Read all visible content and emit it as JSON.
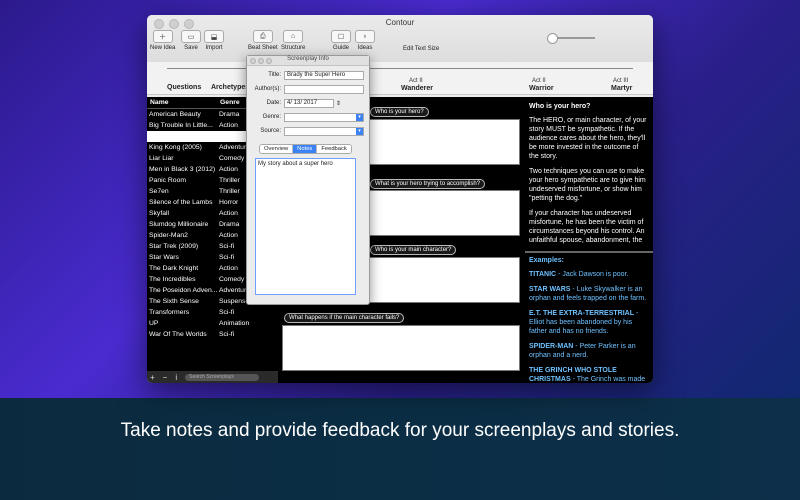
{
  "window": {
    "title": "Contour"
  },
  "toolbar": {
    "items": [
      {
        "label": "New Idea",
        "icon": "plus"
      },
      {
        "label": "Save",
        "icon": "save"
      },
      {
        "label": "Import",
        "icon": "import"
      },
      {
        "label": "Beat Sheet",
        "icon": "printer"
      },
      {
        "label": "Structure",
        "icon": "structure"
      },
      {
        "label": "Guide",
        "icon": "guide"
      },
      {
        "label": "Ideas",
        "icon": "lightbulb"
      },
      {
        "label": "Edit Text Size",
        "icon": "slider"
      }
    ]
  },
  "structure": {
    "labels": [
      "Questions",
      "Archetypes"
    ],
    "acts": [
      {
        "act": "Act II",
        "name": "Wanderer"
      },
      {
        "act": "Act II",
        "name": "Warrior"
      },
      {
        "act": "Act III",
        "name": "Martyr"
      }
    ]
  },
  "list": {
    "headers": {
      "name": "Name",
      "genre": "Genre"
    },
    "rows": [
      {
        "name": "American Beauty",
        "genre": "Drama"
      },
      {
        "name": "Big Trouble In Little...",
        "genre": "Action"
      },
      {
        "name": "Brady the Super Hero",
        "genre": "",
        "selected": true
      },
      {
        "name": "King Kong (2005)",
        "genre": "Adventure"
      },
      {
        "name": "Liar Liar",
        "genre": "Comedy"
      },
      {
        "name": "Men in Black 3 (2012)",
        "genre": "Action"
      },
      {
        "name": "Panic Room",
        "genre": "Thriller"
      },
      {
        "name": "Se7en",
        "genre": "Thriller"
      },
      {
        "name": "Silence of the Lambs",
        "genre": "Horror"
      },
      {
        "name": "Skyfall",
        "genre": "Action"
      },
      {
        "name": "Slumdog Millionaire",
        "genre": "Drama"
      },
      {
        "name": "Spider-Man2",
        "genre": "Action"
      },
      {
        "name": "Star Trek (2009)",
        "genre": "Sci-fi"
      },
      {
        "name": "Star Wars",
        "genre": "Sci-fi"
      },
      {
        "name": "The Dark Knight",
        "genre": "Action"
      },
      {
        "name": "The Incredibles",
        "genre": "Comedy"
      },
      {
        "name": "The Poseidon Adven...",
        "genre": "Adventure"
      },
      {
        "name": "The Sixth Sense",
        "genre": "Suspense"
      },
      {
        "name": "Transformers",
        "genre": "Sci-fi"
      },
      {
        "name": "UP",
        "genre": "Animation"
      },
      {
        "name": "War Of The Worlds",
        "genre": "Sci-fi"
      }
    ],
    "footer": {
      "add": "+",
      "remove": "−",
      "info": "i",
      "search_placeholder": "Search Screenplays"
    }
  },
  "questions": [
    {
      "label": "Who is your hero?"
    },
    {
      "label": "What is your hero trying to accomplish?"
    },
    {
      "label": "Who is your main character?"
    },
    {
      "label": "What happens if the main character fails?"
    }
  ],
  "panel": {
    "title": "Screenplay Info",
    "fields": {
      "title_label": "Title:",
      "title_value": "Brady the Super Hero",
      "authors_label": "Author(s):",
      "authors_value": "",
      "date_label": "Date:",
      "date_value": "4/ 13/ 2017",
      "genre_label": "Genre:",
      "genre_value": "",
      "source_label": "Source:",
      "source_value": ""
    },
    "tabs": [
      "Overview",
      "Notes",
      "Feedback"
    ],
    "active_tab": "Notes",
    "notes_text": "My story about a super hero"
  },
  "guide": {
    "heading": "Who is your hero?",
    "paragraphs": [
      "The HERO, or main character, of your story MUST be sympathetic. If the audience cares about the hero, they'll be more invested in the outcome of the story.",
      "Two techniques you can use to make your hero sympathetic are to give him undeserved misfortune, or show him \"petting the dog.\"",
      "If your character has undeserved misfortune, he has been the victim of circumstances beyond his control. An unfaithful spouse, abandonment, the"
    ],
    "examples_heading": "Examples:",
    "examples": [
      {
        "title": "TITANIC",
        "text": " - Jack Dawson is poor."
      },
      {
        "title": "STAR WARS",
        "text": " - Luke Skywalker is an orphan and feels trapped on the farm."
      },
      {
        "title": "E.T. THE EXTRA-TERRESTRIAL",
        "text": " - Elliot has been abandoned by his father and has no friends."
      },
      {
        "title": "SPIDER-MAN",
        "text": " - Peter Parker is an orphan and a nerd."
      },
      {
        "title": "THE GRINCH WHO STOLE CHRISTMAS",
        "text": " - The Grinch was made fun of as a child over his feelings for"
      }
    ]
  },
  "caption": "Take notes and provide feedback for your screenplays and stories."
}
